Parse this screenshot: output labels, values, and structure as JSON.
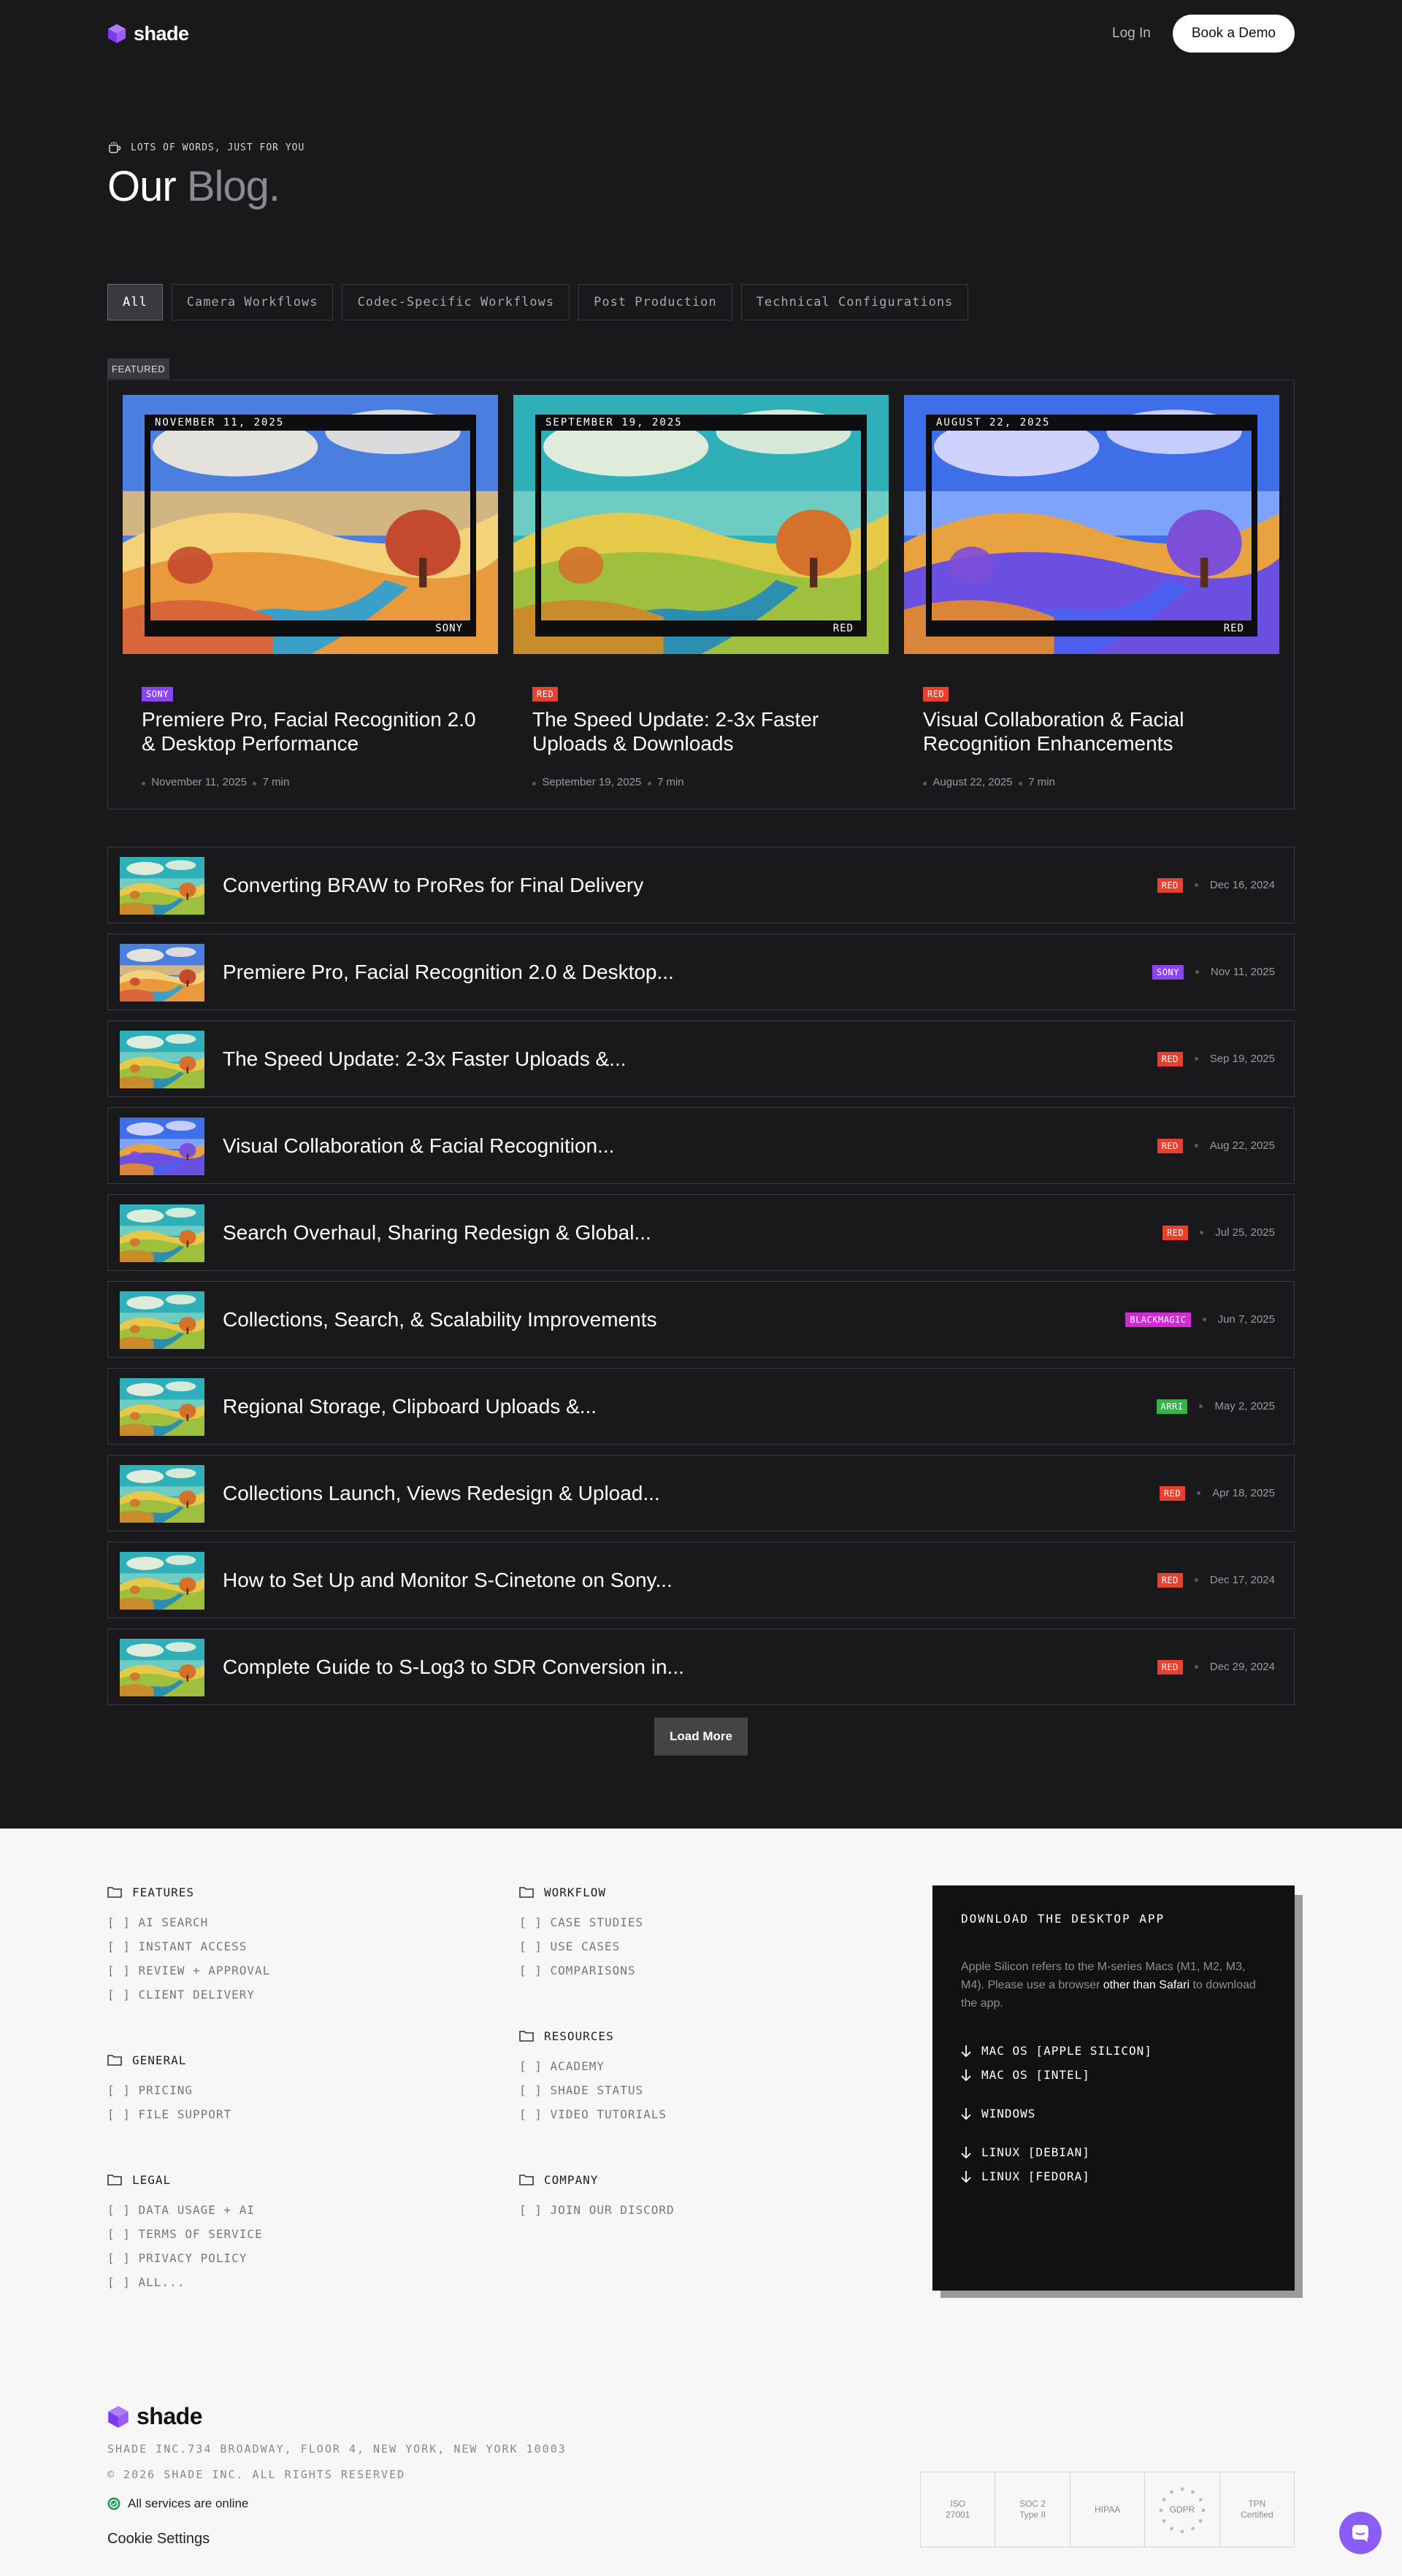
{
  "nav": {
    "brand": "shade",
    "login": "Log In",
    "demo": "Book a Demo"
  },
  "hero": {
    "eyebrow": "LOTS OF WORDS, JUST FOR YOU",
    "title_1": "Our",
    "title_2": "Blog."
  },
  "filters": [
    "All",
    "Camera Workflows",
    "Codec-Specific Workflows",
    "Post Production",
    "Technical Configurations"
  ],
  "active_filter": "All",
  "featured": {
    "label": "FEATURED",
    "cards": [
      {
        "date_banner": "NOVEMBER 11, 2025",
        "brand_banner": "SONY",
        "badge": "SONY",
        "badge_color": "#8b45f0",
        "title": "Premiere Pro, Facial Recognition 2.0 & Desktop Performance",
        "date": "November 11, 2025",
        "read": "7 min"
      },
      {
        "date_banner": "SEPTEMBER 19, 2025",
        "brand_banner": "RED",
        "badge": "RED",
        "badge_color": "#e8402f",
        "title": "The Speed Update: 2-3x Faster Uploads & Downloads",
        "date": "September 19, 2025",
        "read": "7 min"
      },
      {
        "date_banner": "AUGUST 22, 2025",
        "brand_banner": "RED",
        "badge": "RED",
        "badge_color": "#e8402f",
        "title": "Visual Collaboration & Facial Recognition Enhancements",
        "date": "August 22, 2025",
        "read": "7 min"
      }
    ]
  },
  "posts": [
    {
      "title": "Converting BRAW to ProRes for Final Delivery",
      "badge": "RED",
      "badge_color": "#e8402f",
      "date": "Dec 16, 2024"
    },
    {
      "title": "Premiere Pro, Facial Recognition 2.0 & Desktop...",
      "badge": "SONY",
      "badge_color": "#8b45f0",
      "date": "Nov 11, 2025"
    },
    {
      "title": "The Speed Update: 2-3x Faster Uploads &...",
      "badge": "RED",
      "badge_color": "#e8402f",
      "date": "Sep 19, 2025"
    },
    {
      "title": "Visual Collaboration & Facial Recognition...",
      "badge": "RED",
      "badge_color": "#e8402f",
      "date": "Aug 22, 2025"
    },
    {
      "title": "Search Overhaul, Sharing Redesign & Global...",
      "badge": "RED",
      "badge_color": "#e8402f",
      "date": "Jul 25, 2025"
    },
    {
      "title": "Collections, Search, & Scalability Improvements",
      "badge": "BLACKMAGIC",
      "badge_color": "#d12ad4",
      "date": "Jun 7, 2025"
    },
    {
      "title": "Regional Storage, Clipboard Uploads &...",
      "badge": "ARRI",
      "badge_color": "#2fb844",
      "date": "May 2, 2025"
    },
    {
      "title": "Collections Launch, Views Redesign & Upload...",
      "badge": "RED",
      "badge_color": "#e8402f",
      "date": "Apr 18, 2025"
    },
    {
      "title": "How to Set Up and Monitor S-Cinetone on Sony...",
      "badge": "RED",
      "badge_color": "#e8402f",
      "date": "Dec 17, 2024"
    },
    {
      "title": "Complete Guide to S-Log3 to SDR Conversion in...",
      "badge": "RED",
      "badge_color": "#e8402f",
      "date": "Dec 29, 2024"
    }
  ],
  "load_more": "Load More",
  "footer": {
    "features": {
      "heading": "FEATURES",
      "links": [
        "[ ] AI SEARCH",
        "[ ] INSTANT ACCESS",
        "[ ] REVIEW + APPROVAL",
        "[ ] CLIENT DELIVERY"
      ]
    },
    "general": {
      "heading": "GENERAL",
      "links": [
        "[ ] PRICING",
        "[ ] FILE SUPPORT"
      ]
    },
    "legal": {
      "heading": "LEGAL",
      "links": [
        "[ ] DATA USAGE + AI",
        "[ ] TERMS OF SERVICE",
        "[ ] PRIVACY POLICY",
        "[ ] ALL..."
      ]
    },
    "workflow": {
      "heading": "WORKFLOW",
      "links": [
        "[ ] CASE STUDIES",
        "[ ] USE CASES",
        "[ ] COMPARISONS"
      ]
    },
    "resources": {
      "heading": "RESOURCES",
      "links": [
        "[ ] ACADEMY",
        "[ ] SHADE STATUS",
        "[ ] VIDEO TUTORIALS"
      ]
    },
    "company": {
      "heading": "COMPANY",
      "links": [
        "[ ] JOIN OUR DISCORD"
      ]
    },
    "download": {
      "title": "DOWNLOAD THE DESKTOP APP",
      "text_1": "Apple Silicon refers to the M-series Macs (M1, M2, M3, M4). Please use a browser",
      "text_highlight": "other than Safari",
      "text_2": "to download the app.",
      "mac_silicon": "MAC OS [APPLE SILICON]",
      "mac_intel": "MAC OS [INTEL]",
      "windows": "WINDOWS",
      "linux_debian": "LINUX [DEBIAN]",
      "linux_fedora": "LINUX [FEDORA]"
    },
    "brand": "shade",
    "address": "SHADE INC.734 BROADWAY, FLOOR 4, NEW YORK, NEW YORK 10003",
    "copyright": "© 2026 SHADE INC. ALL RIGHTS RESERVED",
    "status": "All services are online",
    "cookie": "Cookie Settings",
    "certs": {
      "iso": "ISO 27001",
      "soc_1": "SOC 2",
      "soc_2": "Type II",
      "hipaa": "HIPAA",
      "gdpr": "GDPR",
      "tpn_1": "TPN",
      "tpn_2": "Certified"
    }
  },
  "colors": {
    "accent": "#8b5cf6",
    "background": "#19181b",
    "footer_bg": "#f7f7f7",
    "status_green": "#22a35a"
  }
}
